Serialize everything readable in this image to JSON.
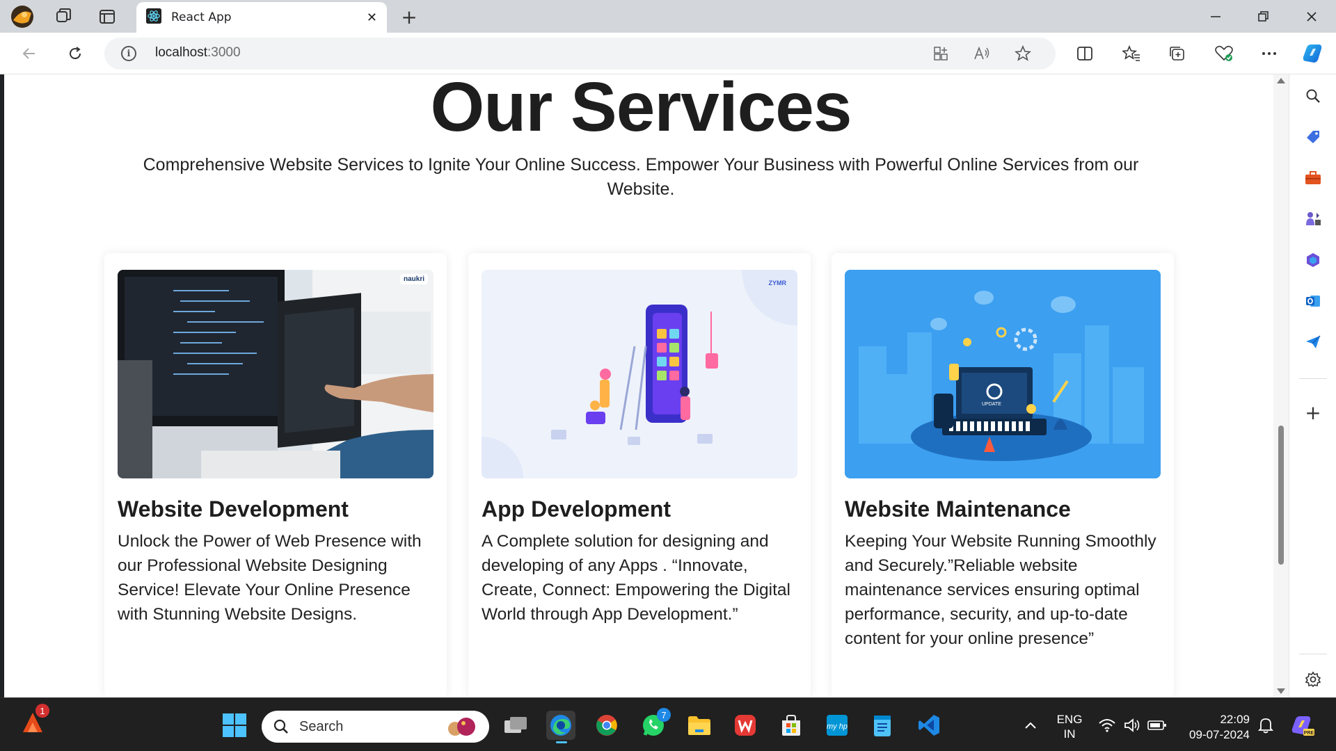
{
  "browser": {
    "tab_title": "React App",
    "url_host": "localhost",
    "url_port": ":3000"
  },
  "page": {
    "title": "Our Services",
    "subtitle": "Comprehensive Website Services to Ignite Your Online Success. Empower Your Business with Powerful Online Services from our Website.",
    "cards": [
      {
        "title": "Website Development",
        "text": "Unlock the Power of Web Presence with our Professional Website Designing Service! Elevate Your Online Presence with Stunning Website Designs.",
        "image_logo": "naukri learning"
      },
      {
        "title": "App Development",
        "text": "A Complete solution for designing and developing of any Apps . “Innovate, Create, Connect: Empowering the Digital World through App Development.”",
        "image_logo": "ZYMR"
      },
      {
        "title": "Website Maintenance",
        "text": "Keeping Your Website Running Smoothly and Securely.”Reliable website maintenance services ensuring optimal performance, security, and up-to-date content for your online presence”",
        "image_label": "UPDATE"
      }
    ]
  },
  "taskbar": {
    "search_label": "Search",
    "notification_badge": "1",
    "whatsapp_badge": "7",
    "language_line1": "ENG",
    "language_line2": "IN",
    "time": "22:09",
    "date": "09-07-2024"
  },
  "colors": {
    "title_bar": "#d3d6da",
    "card_blue": "#3aa0f0",
    "taskbar": "#202020"
  }
}
